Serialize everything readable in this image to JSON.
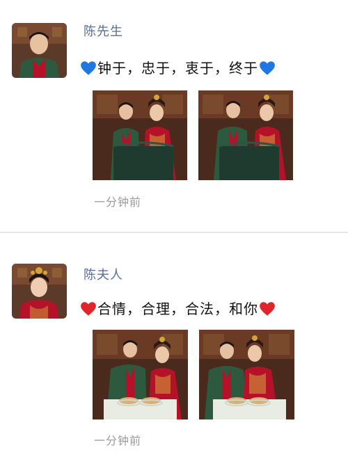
{
  "posts": [
    {
      "author": "陈先生",
      "text": "钟于，忠于，衷于，终于",
      "heart_icon": "blue-heart-icon",
      "heart_color": "#1e78e0",
      "time": "一分钟前",
      "images": [
        "couple-photo-icon",
        "couple-photo-icon"
      ]
    },
    {
      "author": "陈夫人",
      "text": "合情，合理，合法，和你",
      "heart_icon": "red-heart-icon",
      "heart_color": "#e0242b",
      "time": "一分钟前",
      "images": [
        "couple-photo-icon",
        "couple-photo-icon"
      ]
    }
  ],
  "colors": {
    "name": "#5a6c98",
    "time": "#9a9a9a",
    "divider": "#e6e6e6",
    "photo_bg": "#4a2a1c",
    "table_green": "#1f3a2e",
    "qun_red": "#b5122a",
    "robe_green": "#2d5a3e",
    "table_white": "#e9ece2"
  }
}
